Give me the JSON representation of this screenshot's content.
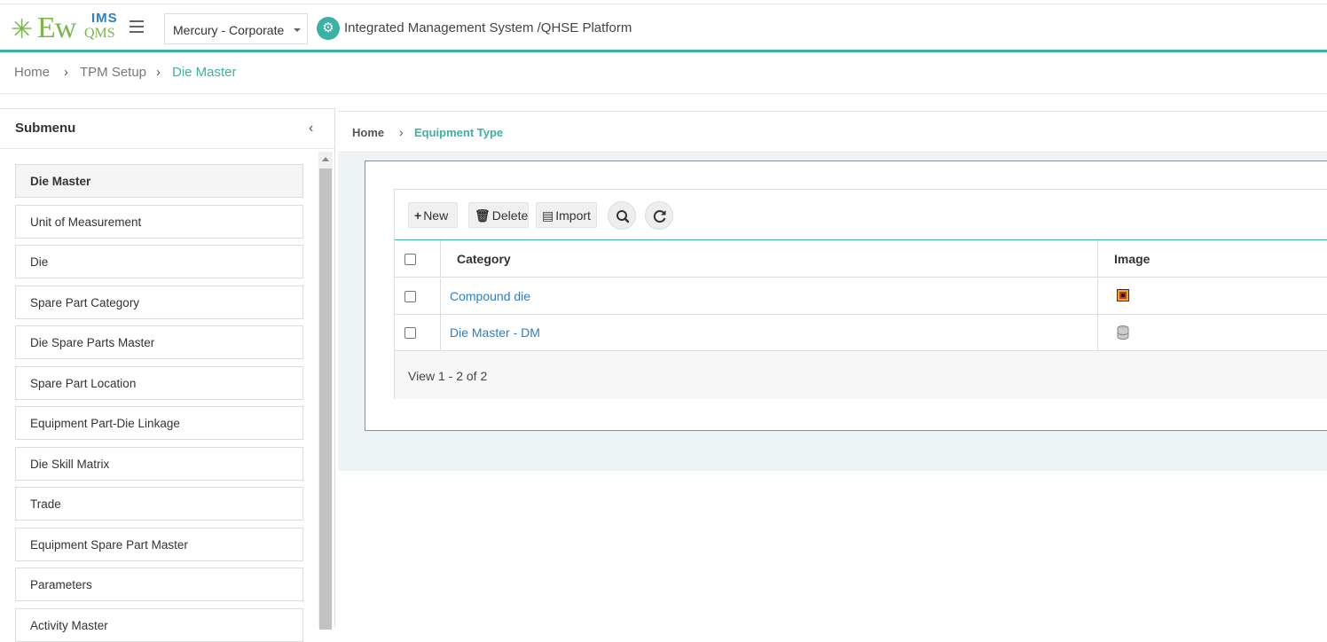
{
  "header": {
    "logo_text_main": "Ew",
    "logo_text_ims": "IMS",
    "logo_text_qms": "QMS",
    "org_select_value": "Mercury - Corporate",
    "platform_title": "Integrated Management System /QHSE Platform"
  },
  "breadcrumb": {
    "items": [
      "Home",
      "TPM Setup",
      "Die Master"
    ]
  },
  "submenu": {
    "title": "Submenu",
    "items": [
      "Die Master",
      "Unit of Measurement",
      "Die",
      "Spare Part Category",
      "Die Spare Parts Master",
      "Spare Part Location",
      "Equipment Part-Die Linkage",
      "Die Skill Matrix",
      "Trade",
      "Equipment Spare Part Master",
      "Parameters",
      "Activity Master"
    ]
  },
  "content": {
    "breadcrumb": [
      "Home",
      "Equipment Type"
    ],
    "toolbar": {
      "new_label": "New",
      "delete_label": "Delete",
      "import_label": "Import"
    },
    "grid": {
      "columns": [
        "Category",
        "Image"
      ],
      "rows": [
        {
          "category": "Compound die",
          "image_icon": "image-thumbnail-icon"
        },
        {
          "category": "Die Master - DM",
          "image_icon": "database-icon"
        }
      ],
      "footer": "View 1 - 2 of 2"
    }
  },
  "colors": {
    "accent": "#3bb3a4",
    "link": "#2b7fc3",
    "logo_green": "#7ab648"
  }
}
